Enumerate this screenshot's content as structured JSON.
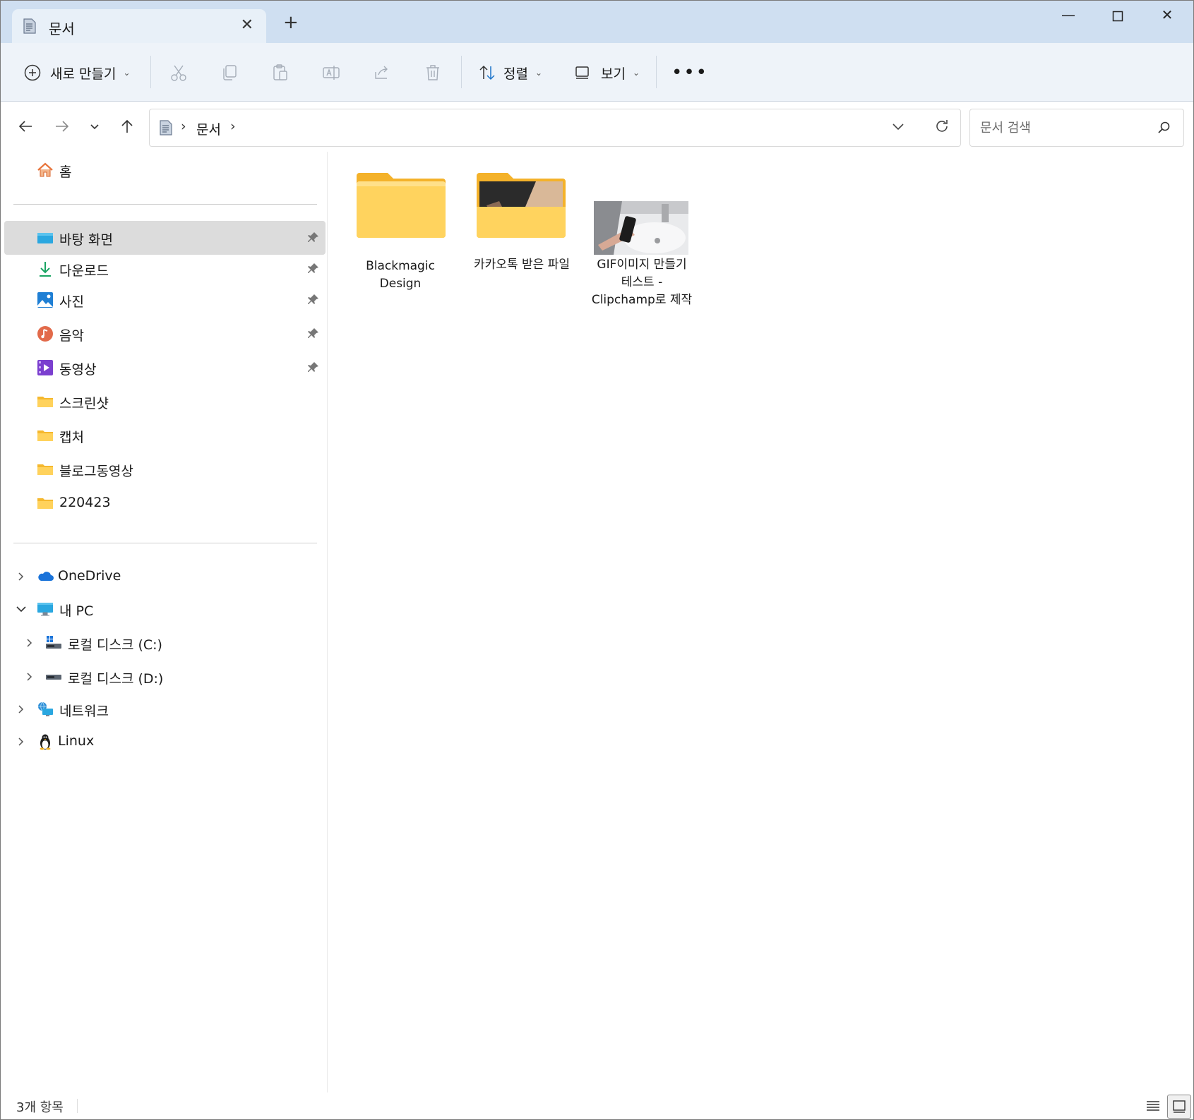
{
  "window": {
    "tab_title": "문서"
  },
  "toolbar": {
    "new_label": "새로 만들기",
    "sort_label": "정렬",
    "view_label": "보기"
  },
  "address": {
    "crumbs": [
      "문서"
    ],
    "search_placeholder": "문서 검색"
  },
  "sidebar": {
    "home": "홈",
    "quick_access": [
      {
        "label": "바탕 화면",
        "icon": "desktop-icon",
        "pinned": true,
        "selected": true
      },
      {
        "label": "다운로드",
        "icon": "download-icon",
        "pinned": true
      },
      {
        "label": "사진",
        "icon": "pictures-icon",
        "pinned": true
      },
      {
        "label": "음악",
        "icon": "music-icon",
        "pinned": true
      },
      {
        "label": "동영상",
        "icon": "videos-icon",
        "pinned": true
      },
      {
        "label": "스크린샷",
        "icon": "folder-icon",
        "pinned": false
      },
      {
        "label": "캡처",
        "icon": "folder-icon",
        "pinned": false
      },
      {
        "label": "블로그동영상",
        "icon": "folder-icon",
        "pinned": false
      },
      {
        "label": "220423",
        "icon": "folder-icon",
        "pinned": false
      }
    ],
    "onedrive": "OneDrive",
    "this_pc": "내 PC",
    "drive_c": "로컬 디스크 (C:)",
    "drive_d": "로컬 디스크 (D:)",
    "network": "네트워크",
    "linux": "Linux"
  },
  "files": [
    {
      "name": "Blackmagic Design",
      "type": "folder"
    },
    {
      "name": "카카오톡 받은 파일",
      "type": "folder-with-preview"
    },
    {
      "name": "GIF이미지 만들기 테스트 - Clipchamp로 제작",
      "type": "video-thumbnail"
    }
  ],
  "status": {
    "item_count": "3개 항목"
  },
  "colors": {
    "title_bar": "#cfdff1",
    "toolbar": "#eef3f9",
    "selection": "#dcdcdc",
    "folder_yellow": "#ffc83d"
  }
}
